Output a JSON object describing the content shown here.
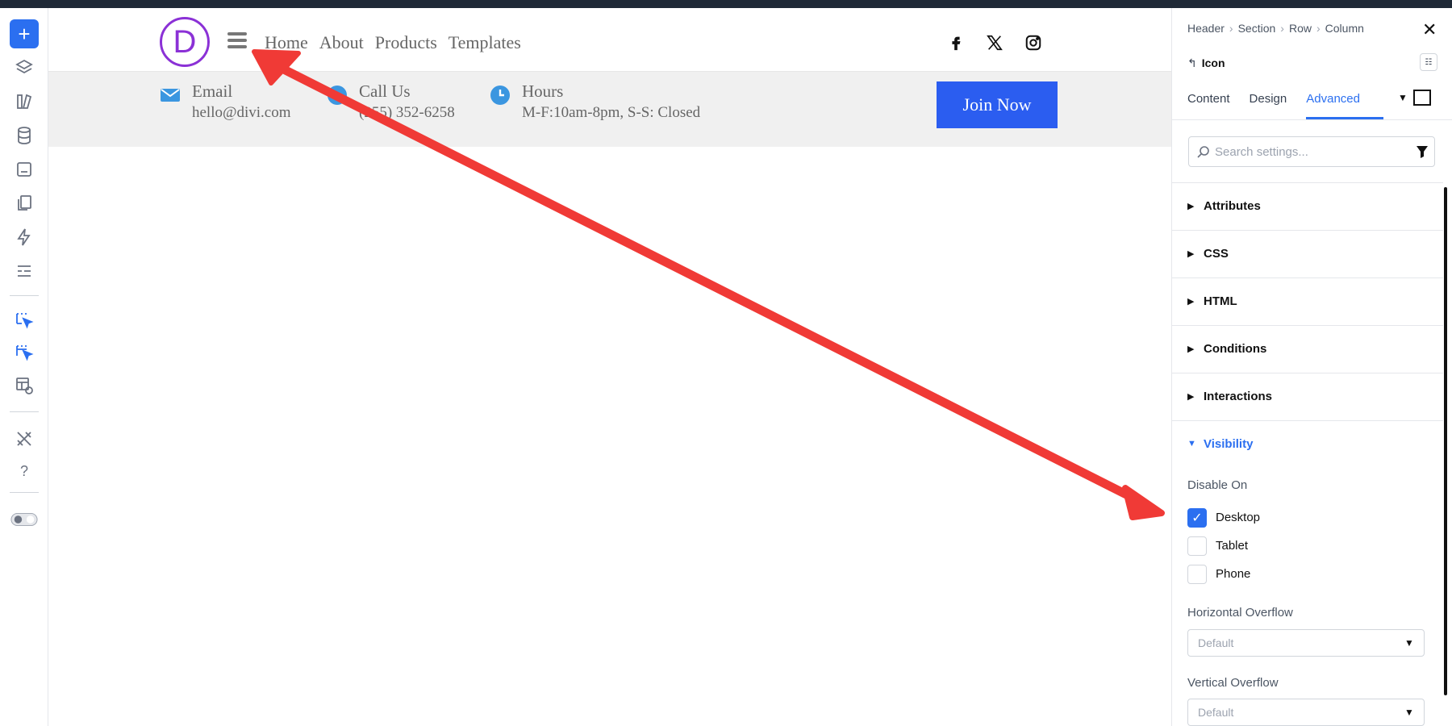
{
  "toolbar": {
    "add_label": "+",
    "items": [
      "add-icon",
      "layers-icon",
      "library-icon",
      "database-icon",
      "portability-icon",
      "pages-icon",
      "lightning-icon",
      "sections-icon",
      "select-icon",
      "multi-select-icon",
      "theme-builder-icon",
      "tools-icon",
      "help-icon",
      "toggle-icon"
    ]
  },
  "site": {
    "logo_letter": "D",
    "nav": [
      "Home",
      "About",
      "Products",
      "Templates"
    ],
    "social": [
      "facebook-icon",
      "x-icon",
      "instagram-icon"
    ],
    "info": [
      {
        "title": "Email",
        "value": "hello@divi.com",
        "icon": "email-icon"
      },
      {
        "title": "Call Us",
        "value": "(255) 352-6258",
        "icon": "phone-icon"
      },
      {
        "title": "Hours",
        "value": "M-F:10am-8pm, S-S: Closed",
        "icon": "clock-icon"
      }
    ],
    "cta": "Join Now",
    "accent": "#2b5df0",
    "brand": "#8b31d6"
  },
  "panel": {
    "breadcrumb": [
      "Header",
      "Section",
      "Row",
      "Column"
    ],
    "element_label": "Icon",
    "tabs": [
      "Content",
      "Design",
      "Advanced"
    ],
    "active_tab": "Advanced",
    "search_placeholder": "Search settings...",
    "accordions": [
      "Attributes",
      "CSS",
      "HTML",
      "Conditions",
      "Interactions",
      "Visibility"
    ],
    "open_accordion": "Visibility",
    "disable_on_label": "Disable On",
    "disable_on": [
      {
        "label": "Desktop",
        "checked": true
      },
      {
        "label": "Tablet",
        "checked": false
      },
      {
        "label": "Phone",
        "checked": false
      }
    ],
    "horizontal_overflow_label": "Horizontal Overflow",
    "horizontal_overflow_value": "Default",
    "vertical_overflow_label": "Vertical Overflow",
    "vertical_overflow_value": "Default"
  },
  "annotation_color": "#f03a36"
}
